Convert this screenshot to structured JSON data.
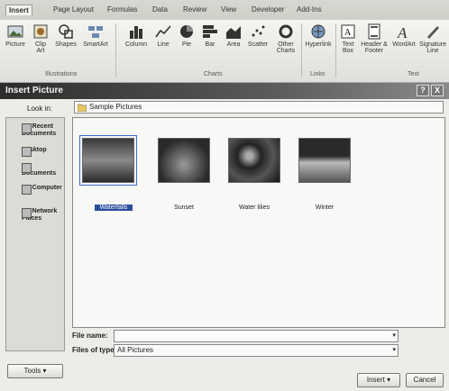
{
  "ribbon": {
    "tabs": [
      "Insert",
      "Page Layout",
      "Formulas",
      "Data",
      "Review",
      "View",
      "Developer",
      "Add-Ins"
    ],
    "buttons": [
      "Picture",
      "Clip Art",
      "Shapes",
      "SmartArt",
      "Column",
      "Line",
      "Pie",
      "Bar",
      "Area",
      "Scatter",
      "Other Charts",
      "Hyperlink",
      "Text Box",
      "Header & Footer",
      "WordArt",
      "Signature Line"
    ],
    "groups": [
      "Illustrations",
      "Charts",
      "Links",
      "Text"
    ]
  },
  "dialog": {
    "title": "Insert Picture",
    "help": "?",
    "close": "X",
    "look_in_label": "Look in:",
    "look_in_value": "Sample Pictures",
    "places": [
      "My Recent Documents",
      "Desktop",
      "My Documents",
      "My Computer",
      "My Network Places"
    ],
    "files": [
      "Waterfalls",
      "Sunset",
      "Water lilies",
      "Winter"
    ],
    "file_name_label": "File name:",
    "file_name_value": "",
    "file_type_label": "Files of type:",
    "file_type_value": "All Pictures",
    "tools": "Tools",
    "insert": "Insert",
    "cancel": "Cancel"
  }
}
